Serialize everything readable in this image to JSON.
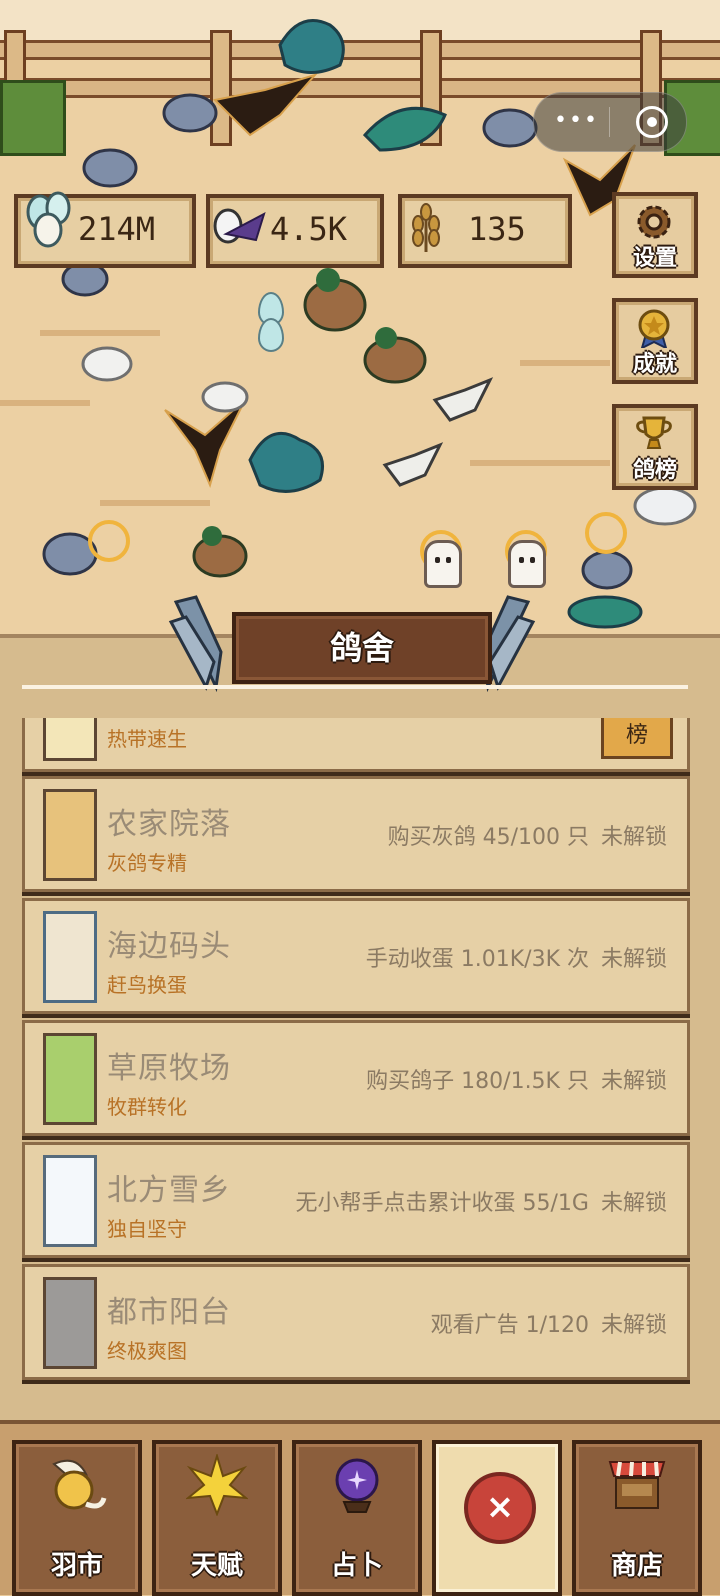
{
  "resources": {
    "eggs": "214M",
    "feathers": "4.5K",
    "wheat": "135"
  },
  "capsule": {
    "more": "•••"
  },
  "side_buttons": {
    "settings": "设置",
    "achievements": "成就",
    "leaderboard": "鸽榜"
  },
  "panel": {
    "title": "鸽舍",
    "rank_label": "榜",
    "farms": [
      {
        "name": "",
        "sub": "热带速生",
        "req": "",
        "status": ""
      },
      {
        "name": "农家院落",
        "sub": "灰鸽专精",
        "req": "购买灰鸽 45/100 只",
        "status": "未解锁"
      },
      {
        "name": "海边码头",
        "sub": "赶鸟换蛋",
        "req": "手动收蛋 1.01K/3K 次",
        "status": "未解锁"
      },
      {
        "name": "草原牧场",
        "sub": "牧群转化",
        "req": "购买鸽子 180/1.5K 只",
        "status": "未解锁"
      },
      {
        "name": "北方雪乡",
        "sub": "独自坚守",
        "req": "无小帮手点击累计收蛋 55/1G",
        "status": "未解锁"
      },
      {
        "name": "都市阳台",
        "sub": "终极爽图",
        "req": "观看广告 1/120",
        "status": "未解锁"
      }
    ]
  },
  "nav": {
    "market": "羽市",
    "talent": "天赋",
    "divination": "占卜",
    "close": "×",
    "shop": "商店"
  },
  "colors": {
    "panel_bg": "#d6bb8e",
    "card_bg": "#e6d0a6",
    "subtitle": "#b87226",
    "close_red": "#c8443a",
    "title_wood": "#6f4128"
  }
}
